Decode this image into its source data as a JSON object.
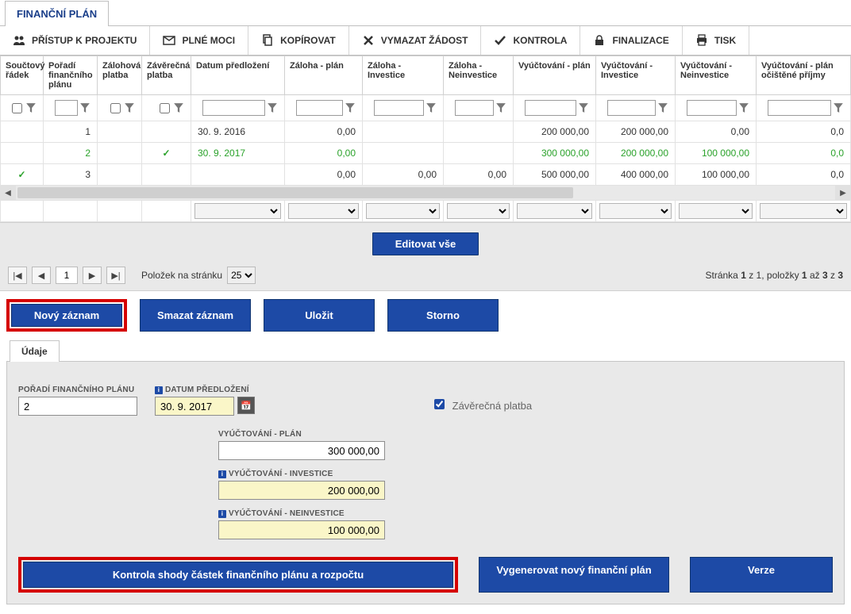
{
  "tabTitle": "FINANČNÍ PLÁN",
  "toolbar": [
    {
      "label": "PŘÍSTUP K PROJEKTU",
      "icon": "users"
    },
    {
      "label": "PLNÉ MOCI",
      "icon": "mail"
    },
    {
      "label": "KOPÍROVAT",
      "icon": "copy"
    },
    {
      "label": "VYMAZAT ŽÁDOST",
      "icon": "delete"
    },
    {
      "label": "KONTROLA",
      "icon": "check"
    },
    {
      "label": "FINALIZACE",
      "icon": "lock"
    },
    {
      "label": "TISK",
      "icon": "print"
    }
  ],
  "columns": [
    "Součtový řádek",
    "Pořadí finančního plánu",
    "Zálohová platba",
    "Závěrečná platba",
    "Datum předložení",
    "Záloha - plán",
    "Záloha - Investice",
    "Záloha - Neinvestice",
    "Vyúčtování - plán",
    "Vyúčtování - Investice",
    "Vyúčtování - Neinvestice",
    "Vyúčtování - plán očištěné příjmy"
  ],
  "rows": [
    {
      "souct": false,
      "poradi": "1",
      "zaloh": false,
      "zaver": false,
      "datum": "30. 9. 2016",
      "zplan": "0,00",
      "zinv": "",
      "znei": "",
      "vplan": "200 000,00",
      "vinv": "200 000,00",
      "vnei": "0,00",
      "voc": "0,0"
    },
    {
      "souct": false,
      "poradi": "2",
      "zaloh": false,
      "zaver": true,
      "datum": "30. 9. 2017",
      "zplan": "0,00",
      "zinv": "",
      "znei": "",
      "vplan": "300 000,00",
      "vinv": "200 000,00",
      "vnei": "100 000,00",
      "voc": "0,0",
      "green": true
    },
    {
      "souct": true,
      "poradi": "3",
      "zaloh": false,
      "zaver": false,
      "datum": "",
      "zplan": "0,00",
      "zinv": "0,00",
      "znei": "0,00",
      "vplan": "500 000,00",
      "vinv": "400 000,00",
      "vnei": "100 000,00",
      "voc": "0,0"
    }
  ],
  "editAll": "Editovat vše",
  "pager": {
    "page": "1",
    "perPageLabel": "Položek na stránku",
    "perPage": "25",
    "statusPrefix": "Stránka ",
    "statusPage": "1",
    "statusMid": " z 1, položky ",
    "statusFrom": "1",
    "statusMid2": " až ",
    "statusTo": "3",
    "statusMid3": " z ",
    "statusTotal": "3"
  },
  "actions": {
    "new": "Nový záznam",
    "delete": "Smazat záznam",
    "save": "Uložit",
    "cancel": "Storno"
  },
  "detailTab": "Údaje",
  "form": {
    "poradiLabel": "POŘADÍ FINANČNÍHO PLÁNU",
    "poradi": "2",
    "datumLabel": "DATUM PŘEDLOŽENÍ",
    "datum": "30. 9. 2017",
    "zaverCheckbox": "Závěrečná platba",
    "zaverChecked": true,
    "vplanLabel": "VYÚČTOVÁNÍ - PLÁN",
    "vplan": "300 000,00",
    "vinvLabel": "VYÚČTOVÁNÍ - INVESTICE",
    "vinv": "200 000,00",
    "vneiLabel": "VYÚČTOVÁNÍ - NEINVESTICE",
    "vnei": "100 000,00"
  },
  "bottom": {
    "check": "Kontrola shody částek finančního plánu a rozpočtu",
    "generate": "Vygenerovat nový finanční plán",
    "version": "Verze"
  }
}
